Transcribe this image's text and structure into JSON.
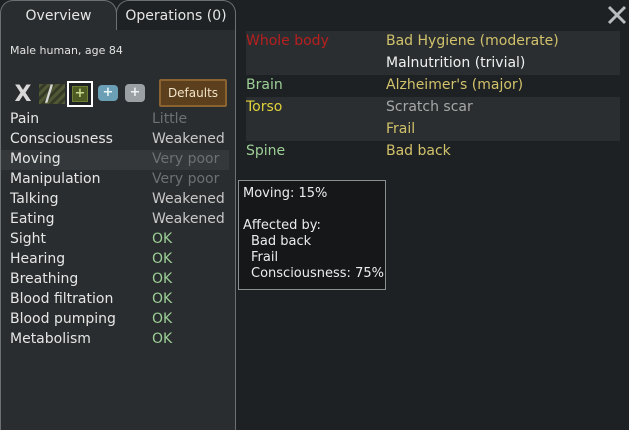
{
  "tabs": [
    {
      "label": "Overview",
      "active": true
    },
    {
      "label": "Operations (0)",
      "active": false
    }
  ],
  "pawn": {
    "description": "Male human, age 84"
  },
  "toolbar": {
    "buttons": [
      "x-icon",
      "slash-icon",
      "medicine-herbal-icon",
      "medicine-industrial-icon",
      "medicine-glitterworld-icon"
    ],
    "x_label": "X",
    "slash_label": "/",
    "plus_label": "+",
    "defaults_label": "Defaults"
  },
  "capacities": [
    {
      "name": "Pain",
      "value": "Little",
      "color": "#6e7072"
    },
    {
      "name": "Consciousness",
      "value": "Weakened",
      "color": "#c8c8c8"
    },
    {
      "name": "Moving",
      "value": "Very poor",
      "color": "#6e7072",
      "highlighted": true
    },
    {
      "name": "Manipulation",
      "value": "Very poor",
      "color": "#6e7072"
    },
    {
      "name": "Talking",
      "value": "Weakened",
      "color": "#c8c8c8"
    },
    {
      "name": "Eating",
      "value": "Weakened",
      "color": "#c8c8c8"
    },
    {
      "name": "Sight",
      "value": "OK",
      "color": "#9ccf96"
    },
    {
      "name": "Hearing",
      "value": "OK",
      "color": "#9ccf96"
    },
    {
      "name": "Breathing",
      "value": "OK",
      "color": "#9ccf96"
    },
    {
      "name": "Blood filtration",
      "value": "OK",
      "color": "#9ccf96"
    },
    {
      "name": "Blood pumping",
      "value": "OK",
      "color": "#9ccf96"
    },
    {
      "name": "Metabolism",
      "value": "OK",
      "color": "#9ccf96"
    }
  ],
  "health": [
    {
      "part": "Whole body",
      "part_color": "#b81f1f",
      "condition": "Bad Hygiene (moderate)",
      "cond_color": "#d1c26b",
      "shade": true
    },
    {
      "part": "",
      "part_color": "#b81f1f",
      "condition": "Malnutrition (trivial)",
      "cond_color": "#f0f0f0",
      "shade": true
    },
    {
      "part": "Brain",
      "part_color": "#9ccf96",
      "condition": "Alzheimer's (major)",
      "cond_color": "#d1c26b",
      "shade": false
    },
    {
      "part": "Torso",
      "part_color": "#e0d23a",
      "condition": "Scratch scar",
      "cond_color": "#a8a8a8",
      "shade": true
    },
    {
      "part": "",
      "part_color": "#e0d23a",
      "condition": "Frail",
      "cond_color": "#d1c26b",
      "shade": true
    },
    {
      "part": "Spine",
      "part_color": "#9ccf96",
      "condition": "Bad back",
      "cond_color": "#d1c26b",
      "shade": false
    }
  ],
  "tooltip": {
    "title": "Moving: 15%",
    "affected_label": "Affected by:",
    "factors": [
      "Bad back",
      "Frail",
      "Consciousness: 75%"
    ]
  },
  "close": {
    "icon": "close-icon"
  }
}
